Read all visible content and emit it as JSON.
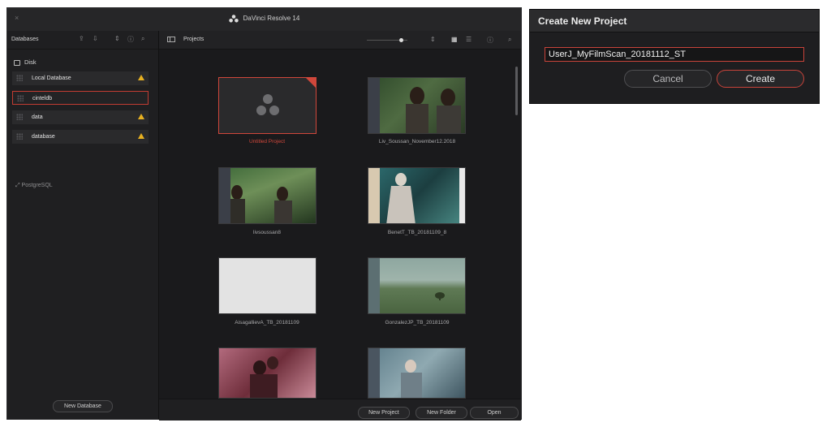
{
  "app": {
    "title": "DaVinci Resolve 14",
    "close_glyph": "×"
  },
  "databases_panel": {
    "header": "Databases",
    "section_disk": "Disk",
    "items": [
      {
        "label": "Local Database",
        "warning": true
      },
      {
        "label": "cinteldb",
        "warning": false,
        "selected": true
      },
      {
        "label": "data",
        "warning": true
      },
      {
        "label": "database",
        "warning": true
      }
    ],
    "postgres_label": "PostgreSQL",
    "new_database_button": "New Database"
  },
  "projects_panel": {
    "header": "Projects",
    "projects": [
      {
        "name": "Untitled Project",
        "selected": true
      },
      {
        "name": "Liv_Soussan_November12.2018"
      },
      {
        "name": "livsoussan8"
      },
      {
        "name": "BenetT_TB_20181109_8"
      },
      {
        "name": "AisagallievA_TB_20181109"
      },
      {
        "name": "GonzalezJP_TB_20181109"
      },
      {
        "name": ""
      },
      {
        "name": ""
      }
    ],
    "buttons": {
      "new_project": "New Project",
      "new_folder": "New Folder",
      "open": "Open"
    }
  },
  "dialog": {
    "title": "Create New Project",
    "input_value": "UserJ_MyFilmScan_20181112_ST",
    "cancel": "Cancel",
    "create": "Create"
  },
  "colors": {
    "accent_red": "#d0473b",
    "warning": "#e6b021",
    "bg_dark": "#1c1c1e"
  }
}
